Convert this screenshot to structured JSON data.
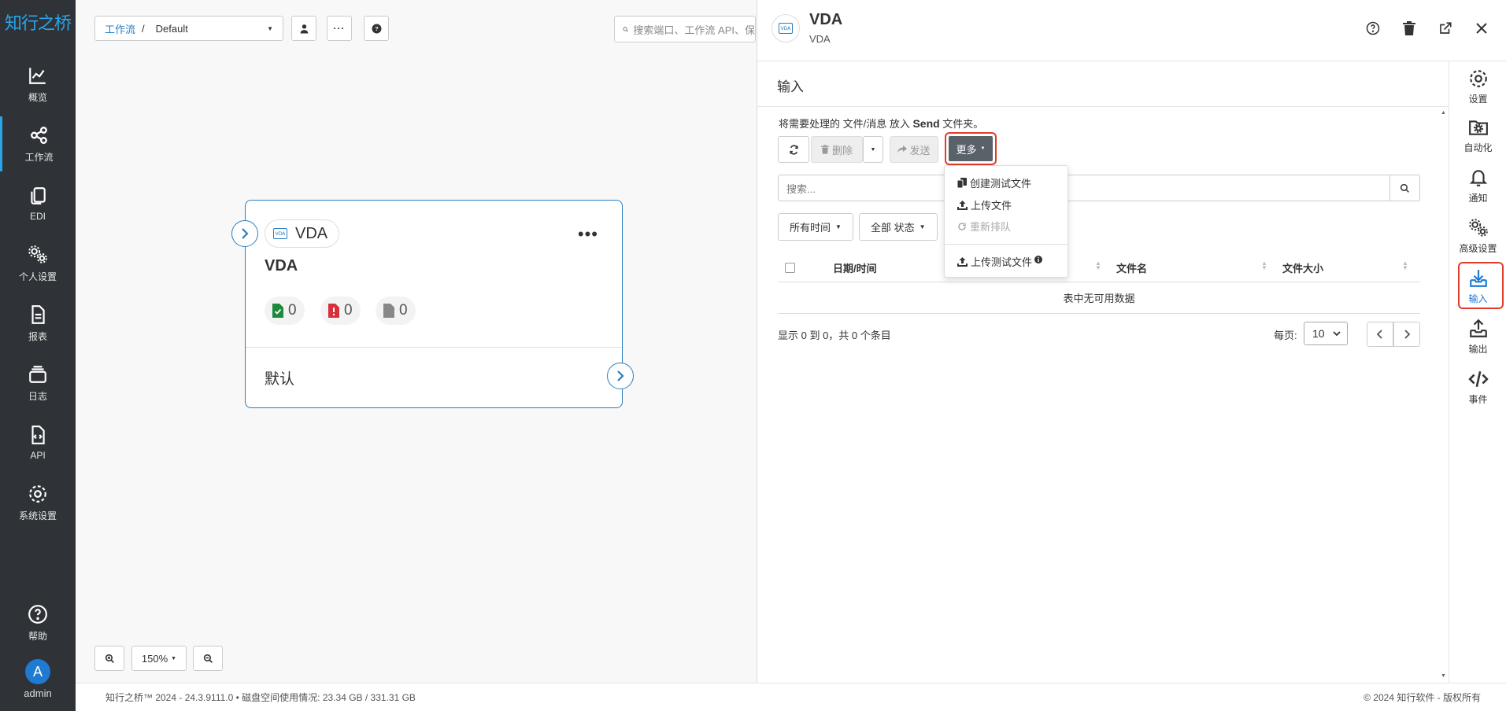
{
  "sidebar": {
    "logo": "知行之桥",
    "items": [
      {
        "label": "概览",
        "icon": "chart-line-icon"
      },
      {
        "label": "工作流",
        "icon": "share-nodes-icon"
      },
      {
        "label": "EDI",
        "icon": "copy-icon"
      },
      {
        "label": "个人设置",
        "icon": "gears-icon"
      },
      {
        "label": "报表",
        "icon": "file-text-icon"
      },
      {
        "label": "日志",
        "icon": "layers-icon"
      },
      {
        "label": "API",
        "icon": "file-code-icon"
      },
      {
        "label": "系统设置",
        "icon": "gear-icon"
      },
      {
        "label": "帮助",
        "icon": "question-circle-icon"
      }
    ],
    "user": {
      "initial": "A",
      "name": "admin"
    }
  },
  "topbar": {
    "breadcrumb_link": "工作流",
    "breadcrumb_sep": "/",
    "workflow": "Default",
    "search_placeholder": "搜索端口、工作流 API、保"
  },
  "node": {
    "badge": "VDA",
    "badge_icon_text": "VDA",
    "title": "VDA",
    "stats": {
      "success": "0",
      "error": "0",
      "pending": "0"
    },
    "footer": "默认"
  },
  "zoom": {
    "level": "150%"
  },
  "footer": {
    "left": "知行之桥™ 2024 - 24.3.9111.0  •  磁盘空间使用情况:  23.34 GB / 331.31 GB",
    "right": "© 2024 知行软件 - 版权所有"
  },
  "panel": {
    "title": "VDA",
    "subtitle": "VDA",
    "section": "输入",
    "hint_prefix": "将需要处理的 文件/消息 放入 ",
    "hint_folder": "Send",
    "hint_suffix": " 文件夹。",
    "toolbar": {
      "delete": "删除",
      "send": "发送",
      "more": "更多"
    },
    "search_placeholder": "搜索...",
    "filters": {
      "time": "所有时间",
      "status": "全部 状态"
    },
    "columns": {
      "datetime": "日期/时间",
      "filename": "文件名",
      "filesize": "文件大小"
    },
    "empty": "表中无可用数据",
    "info": "显示 0 到 0，共 0 个条目",
    "per_page_label": "每页:",
    "per_page": "10",
    "dropdown": {
      "create_test": "创建测试文件",
      "upload": "上传文件",
      "requeue": "重新排队",
      "upload_test": "上传测试文件"
    }
  },
  "rail": [
    {
      "label": "设置",
      "icon": "gear-icon"
    },
    {
      "label": "自动化",
      "icon": "folder-gear-icon"
    },
    {
      "label": "通知",
      "icon": "bell-icon"
    },
    {
      "label": "高级设置",
      "icon": "gears-icon"
    },
    {
      "label": "输入",
      "icon": "download-tray-icon"
    },
    {
      "label": "输出",
      "icon": "upload-tray-icon"
    },
    {
      "label": "事件",
      "icon": "code-icon"
    }
  ],
  "colors": {
    "accent": "#2a7ec0",
    "highlight": "#e03c2c",
    "sidebar": "#2f3337"
  }
}
